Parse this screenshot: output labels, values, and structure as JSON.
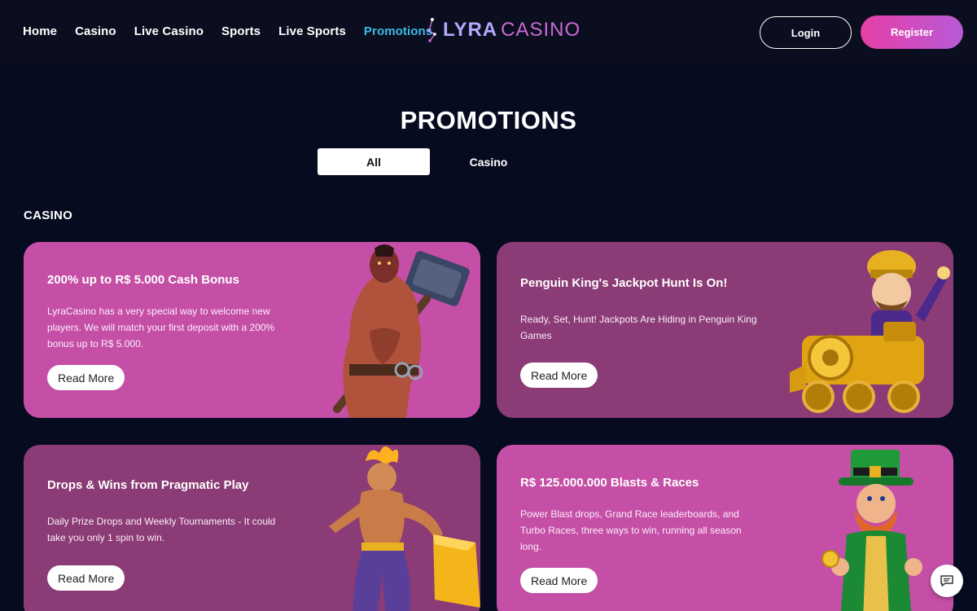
{
  "nav": {
    "items": [
      {
        "label": "Home",
        "active": false
      },
      {
        "label": "Casino",
        "active": false
      },
      {
        "label": "Live Casino",
        "active": false
      },
      {
        "label": "Sports",
        "active": false
      },
      {
        "label": "Live Sports",
        "active": false
      },
      {
        "label": "Promotions",
        "active": true
      }
    ],
    "active_color": "#3fb8e8"
  },
  "logo": {
    "part1": "LYRA",
    "part2": "CASINO",
    "icon": "constellation-icon"
  },
  "auth": {
    "login_label": "Login",
    "register_label": "Register"
  },
  "page": {
    "title": "PROMOTIONS",
    "tabs": [
      {
        "label": "All",
        "selected": true
      },
      {
        "label": "Casino",
        "selected": false
      }
    ],
    "section_heading": "CASINO"
  },
  "cards": [
    {
      "title": "200% up to R$ 5.000 Cash Bonus",
      "description": "LyraCasino has a very special way to welcome new players. We will match your first deposit with a 200% bonus up to R$ 5.000.",
      "button_label": "Read More",
      "bg_color": "#c54fa6",
      "art": "warrior-hammer-illustration"
    },
    {
      "title": "Penguin King's Jackpot Hunt Is On!",
      "description": "Ready, Set, Hunt! Jackpots Are Hiding in Penguin King Games",
      "button_label": "Read More",
      "bg_color": "#8b3b75",
      "art": "gold-train-conductor-illustration"
    },
    {
      "title": "Drops & Wins from Pragmatic Play",
      "description": "Daily Prize Drops and Weekly Tournaments - It could take you only 1 spin to win.",
      "button_label": "Read More",
      "bg_color": "#8b3b75",
      "art": "fire-genie-illustration"
    },
    {
      "title": "R$ 125.000.000 Blasts & Races",
      "description": "Power Blast drops, Grand Race leaderboards, and Turbo Races, three ways to win, running all season long.",
      "button_label": "Read More",
      "bg_color": "#c54fa6",
      "art": "leprechaun-illustration"
    }
  ],
  "chat": {
    "icon": "chat-icon"
  }
}
